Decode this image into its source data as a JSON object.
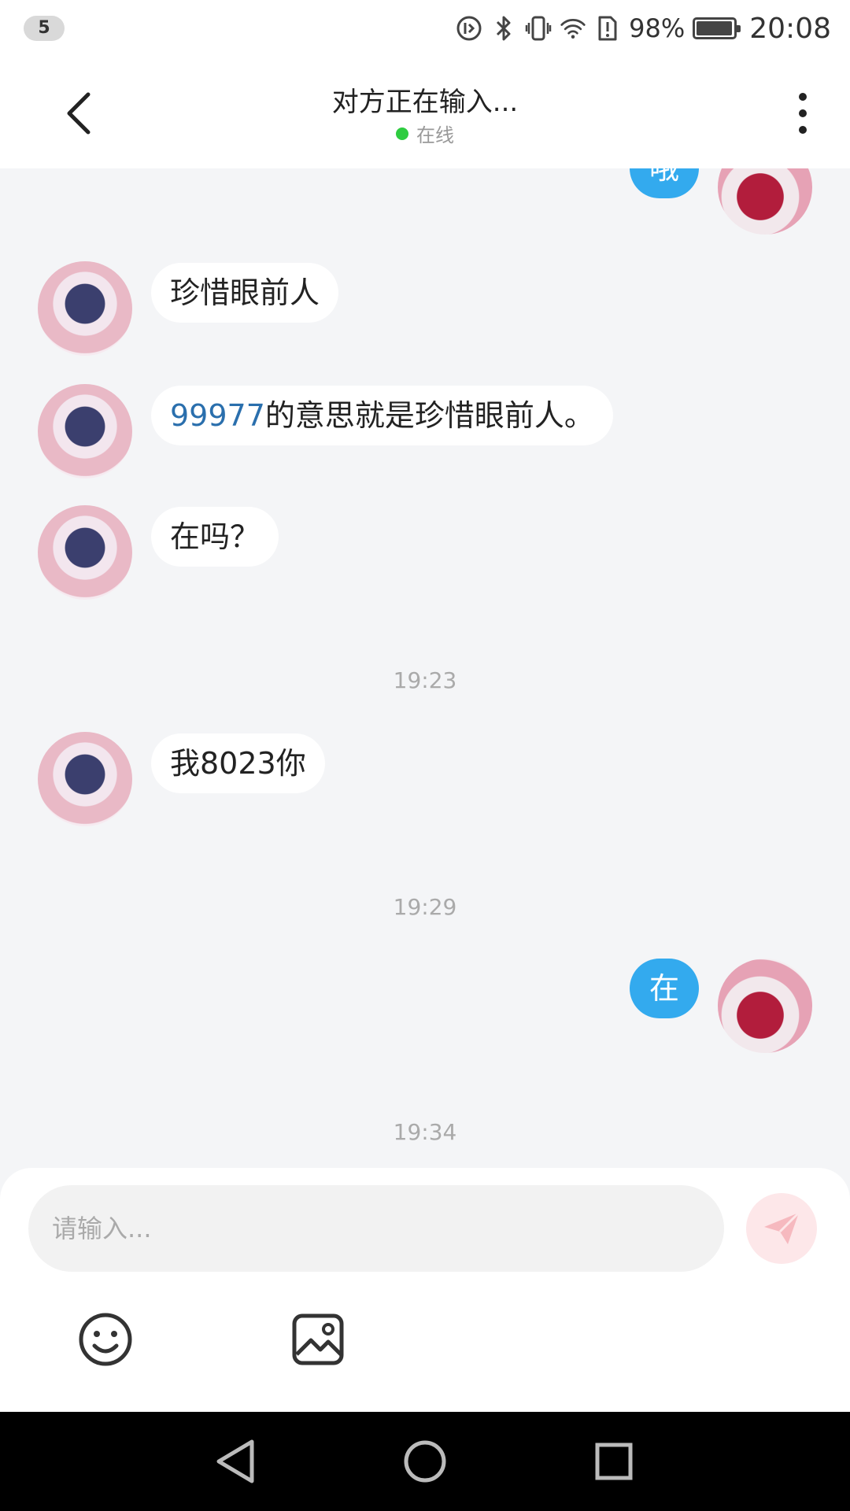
{
  "status_bar": {
    "notification_count": "5",
    "battery_percent": "98%",
    "battery_level": 0.98,
    "time": "20:08",
    "icons": [
      "data-saver-icon",
      "bluetooth-icon",
      "vibrate-icon",
      "wifi-icon",
      "alert-sim-icon",
      "battery-icon"
    ]
  },
  "header": {
    "title": "对方正在输入...",
    "status": "在线",
    "status_color": "#2ecc40",
    "back_icon": "chevron-left-icon",
    "more_icon": "more-vertical-icon"
  },
  "chat": {
    "partial_top_message": "哦",
    "messages": [
      {
        "side": "left",
        "text": "珍惜眼前人"
      },
      {
        "side": "left",
        "link_text": "99977",
        "rest_text": "的意思就是珍惜眼前人。"
      },
      {
        "side": "left",
        "text": "在吗？"
      },
      {
        "side": "left",
        "text": "我8023你"
      },
      {
        "side": "right",
        "text": "在"
      }
    ],
    "timestamps": [
      "19:23",
      "19:29",
      "19:34"
    ],
    "outgoing_bubble_color": "#33aaee"
  },
  "composer": {
    "placeholder": "请输入...",
    "value": "",
    "send_icon": "send-icon",
    "emoji_icon": "smiley-icon",
    "image_icon": "image-icon"
  },
  "nav": {
    "back_icon": "nav-back-icon",
    "home_icon": "nav-home-icon",
    "recents_icon": "nav-recents-icon"
  }
}
